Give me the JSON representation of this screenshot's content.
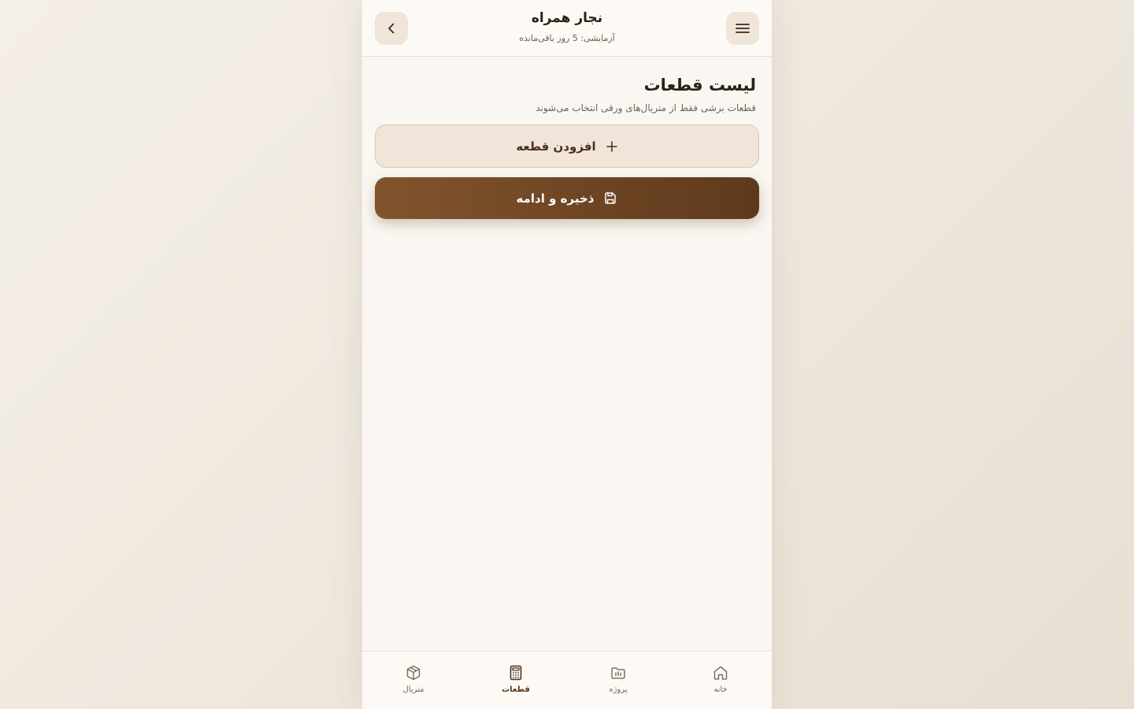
{
  "header": {
    "app_title": "نجار همراه",
    "trial_text": "آزمایشی: 5 روز باقی‌مانده"
  },
  "main": {
    "page_title": "لیست قطعات",
    "page_subtitle": "قطعات برشی فقط از متریال‌های ورقی انتخاب می‌شوند",
    "add_button_label": "افزودن قطعه",
    "save_button_label": "ذخیره و ادامه"
  },
  "bottom_nav": {
    "items": [
      {
        "label": "خانه",
        "icon": "home-icon",
        "active": false
      },
      {
        "label": "پروژه",
        "icon": "project-icon",
        "active": false
      },
      {
        "label": "قطعات",
        "icon": "calculator-icon",
        "active": true
      },
      {
        "label": "متریال",
        "icon": "box-icon",
        "active": false
      }
    ]
  },
  "colors": {
    "primary": "#6e4524",
    "primary_light": "#f0e5d8",
    "background": "#faf7f2",
    "text_dark": "#2d2118"
  }
}
